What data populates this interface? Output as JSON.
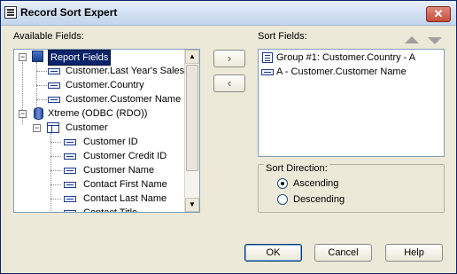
{
  "window": {
    "title": "Record Sort Expert",
    "close_glyph": "✕"
  },
  "available_fields": {
    "label": "Available Fields:",
    "tree": [
      {
        "label": "Report Fields"
      },
      {
        "label": "Customer.Last Year's Sales"
      },
      {
        "label": "Customer.Country"
      },
      {
        "label": "Customer.Customer Name"
      },
      {
        "label": "Xtreme (ODBC (RDO))"
      },
      {
        "label": "Customer"
      },
      {
        "label": "Customer ID"
      },
      {
        "label": "Customer Credit ID"
      },
      {
        "label": "Customer Name"
      },
      {
        "label": "Contact First Name"
      },
      {
        "label": "Contact Last Name"
      },
      {
        "label": "Contact Title"
      }
    ]
  },
  "move_buttons": {
    "add": "›",
    "remove": "‹"
  },
  "sort_fields": {
    "label": "Sort Fields:",
    "items": [
      {
        "label": "Group #1: Customer.Country - A"
      },
      {
        "label": "A - Customer.Customer Name"
      }
    ]
  },
  "sort_direction": {
    "label": "Sort Direction:",
    "options": [
      {
        "label": "Ascending",
        "checked": true
      },
      {
        "label": "Descending",
        "checked": false
      }
    ]
  },
  "footer": {
    "ok": "OK",
    "cancel": "Cancel",
    "help": "Help"
  },
  "scroll": {
    "up": "▲",
    "down": "▼"
  },
  "tree_expander": {
    "collapse": "−"
  }
}
